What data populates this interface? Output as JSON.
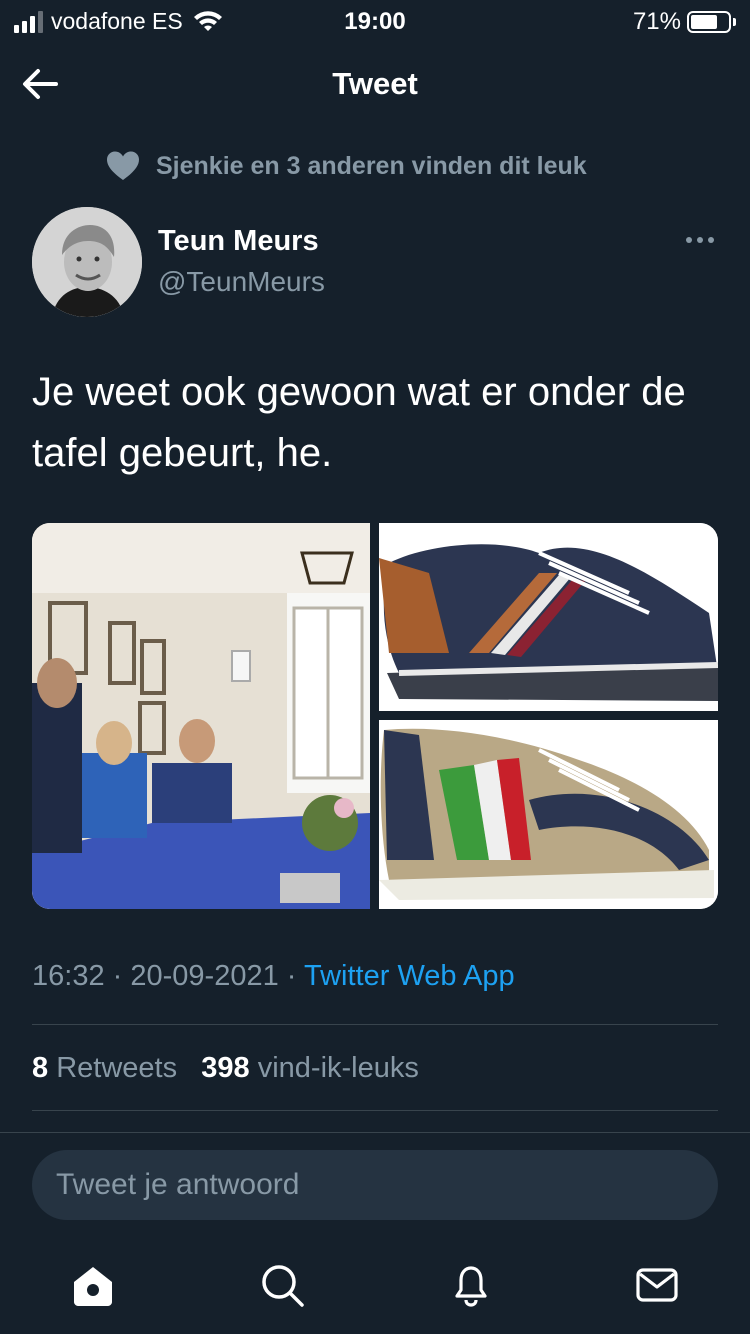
{
  "status_bar": {
    "carrier": "vodafone ES",
    "time": "19:00",
    "battery": "71%",
    "battery_level": 0.71
  },
  "header": {
    "title": "Tweet"
  },
  "social_context": {
    "text": "Sjenkie en 3 anderen vinden dit leuk",
    "icon": "heart-icon"
  },
  "author": {
    "name": "Teun Meurs",
    "handle": "@TeunMeurs"
  },
  "tweet": {
    "text": "Je weet ook gewoon wat er onder de tafel gebeurt, he."
  },
  "meta": {
    "time": "16:32",
    "separator": "·",
    "date": "20-09-2021",
    "source": "Twitter Web App"
  },
  "stats": {
    "retweets_count": "8",
    "retweets_label": "Retweets",
    "likes_count": "398",
    "likes_label": "vind-ik-leuks"
  },
  "reply": {
    "placeholder": "Tweet je antwoord"
  },
  "tab_bar": {
    "icons": [
      "home-icon",
      "search-icon",
      "notifications-icon",
      "messages-icon"
    ]
  },
  "colors": {
    "background": "#15202b",
    "secondary_text": "#8899a6",
    "accent": "#1da1f2",
    "divider": "#38444d",
    "input_background": "#253341"
  }
}
